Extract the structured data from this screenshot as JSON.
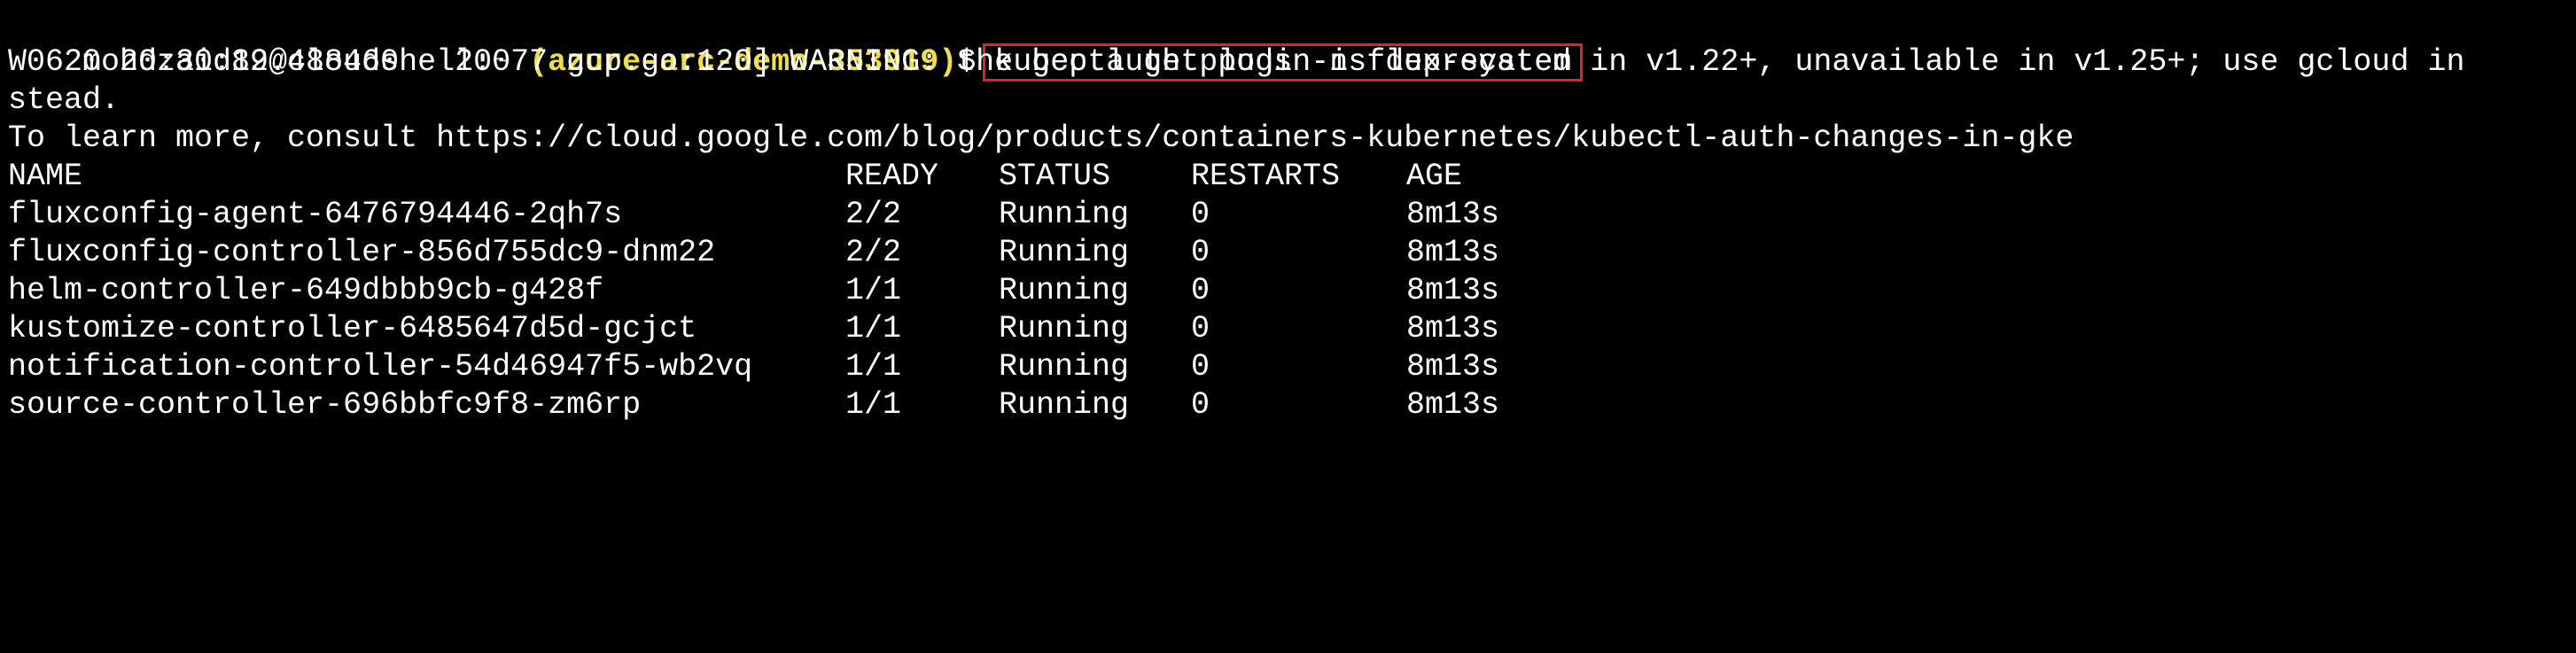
{
  "prompt": {
    "user_host": "mohdzaid89@cloudshell:",
    "tilde": "~",
    "project": "(azure-arc-demo-353919)",
    "dollar": "$",
    "command": "kubectl get pods -n flux-system"
  },
  "output": {
    "warning_line1": "W0620 20:30:12.488460   20077 gcp.go:120] WARNING: the gcp auth plugin is deprecated in v1.22+, unavailable in v1.25+; use gcloud in",
    "warning_line2": "stead.",
    "learn_more": "To learn more, consult https://cloud.google.com/blog/products/containers-kubernetes/kubectl-auth-changes-in-gke"
  },
  "table": {
    "headers": [
      "NAME",
      "READY",
      "STATUS",
      "RESTARTS",
      "AGE"
    ],
    "rows": [
      [
        "fluxconfig-agent-6476794446-2qh7s",
        "2/2",
        "Running",
        "0",
        "8m13s"
      ],
      [
        "fluxconfig-controller-856d755dc9-dnm22",
        "2/2",
        "Running",
        "0",
        "8m13s"
      ],
      [
        "helm-controller-649dbbb9cb-g428f",
        "1/1",
        "Running",
        "0",
        "8m13s"
      ],
      [
        "kustomize-controller-6485647d5d-gcjct",
        "1/1",
        "Running",
        "0",
        "8m13s"
      ],
      [
        "notification-controller-54d46947f5-wb2vq",
        "1/1",
        "Running",
        "0",
        "8m13s"
      ],
      [
        "source-controller-696bbfc9f8-zm6rp",
        "1/1",
        "Running",
        "0",
        "8m13s"
      ]
    ]
  },
  "colors": {
    "background": "#000000",
    "text": "#ffffff",
    "project": "#f2e13c",
    "highlight_box": "#d9232d"
  }
}
